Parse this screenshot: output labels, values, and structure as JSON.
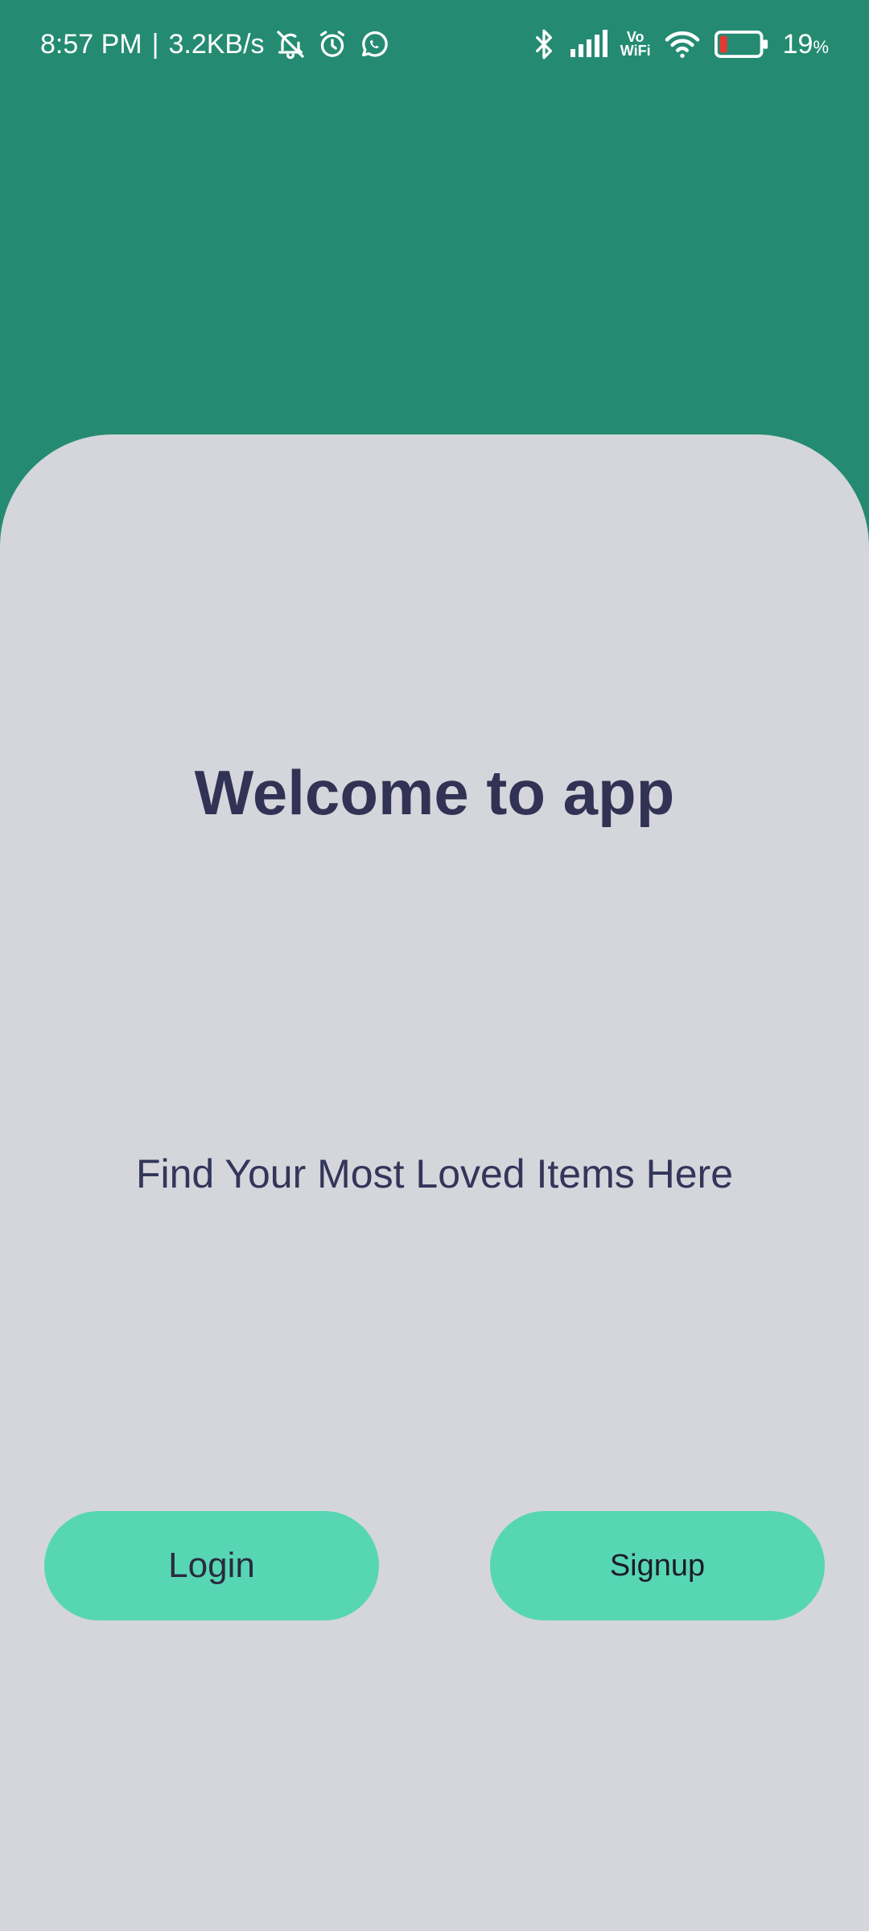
{
  "status_bar": {
    "time": "8:57 PM",
    "separator": "|",
    "net_speed": "3.2KB/s",
    "icons_left": [
      "bell-off-icon",
      "alarm-icon",
      "whatsapp-icon"
    ],
    "icons_right": [
      "bluetooth-icon",
      "signal-icon",
      "vowifi-icon",
      "wifi-icon",
      "battery-icon"
    ],
    "vo_label": "Vo",
    "wifi_label": "WiFi",
    "battery_value": "19",
    "battery_unit": "%",
    "battery_level": 0.19
  },
  "colors": {
    "header_bg": "#248b72",
    "card_bg": "#d4d6db",
    "button_bg": "#57d6b4",
    "title_text": "#323255",
    "battery_low": "#e53935"
  },
  "main": {
    "title": "Welcome to app",
    "subtitle": "Find Your Most Loved Items Here"
  },
  "buttons": {
    "login_label": "Login",
    "signup_label": "Signup"
  }
}
